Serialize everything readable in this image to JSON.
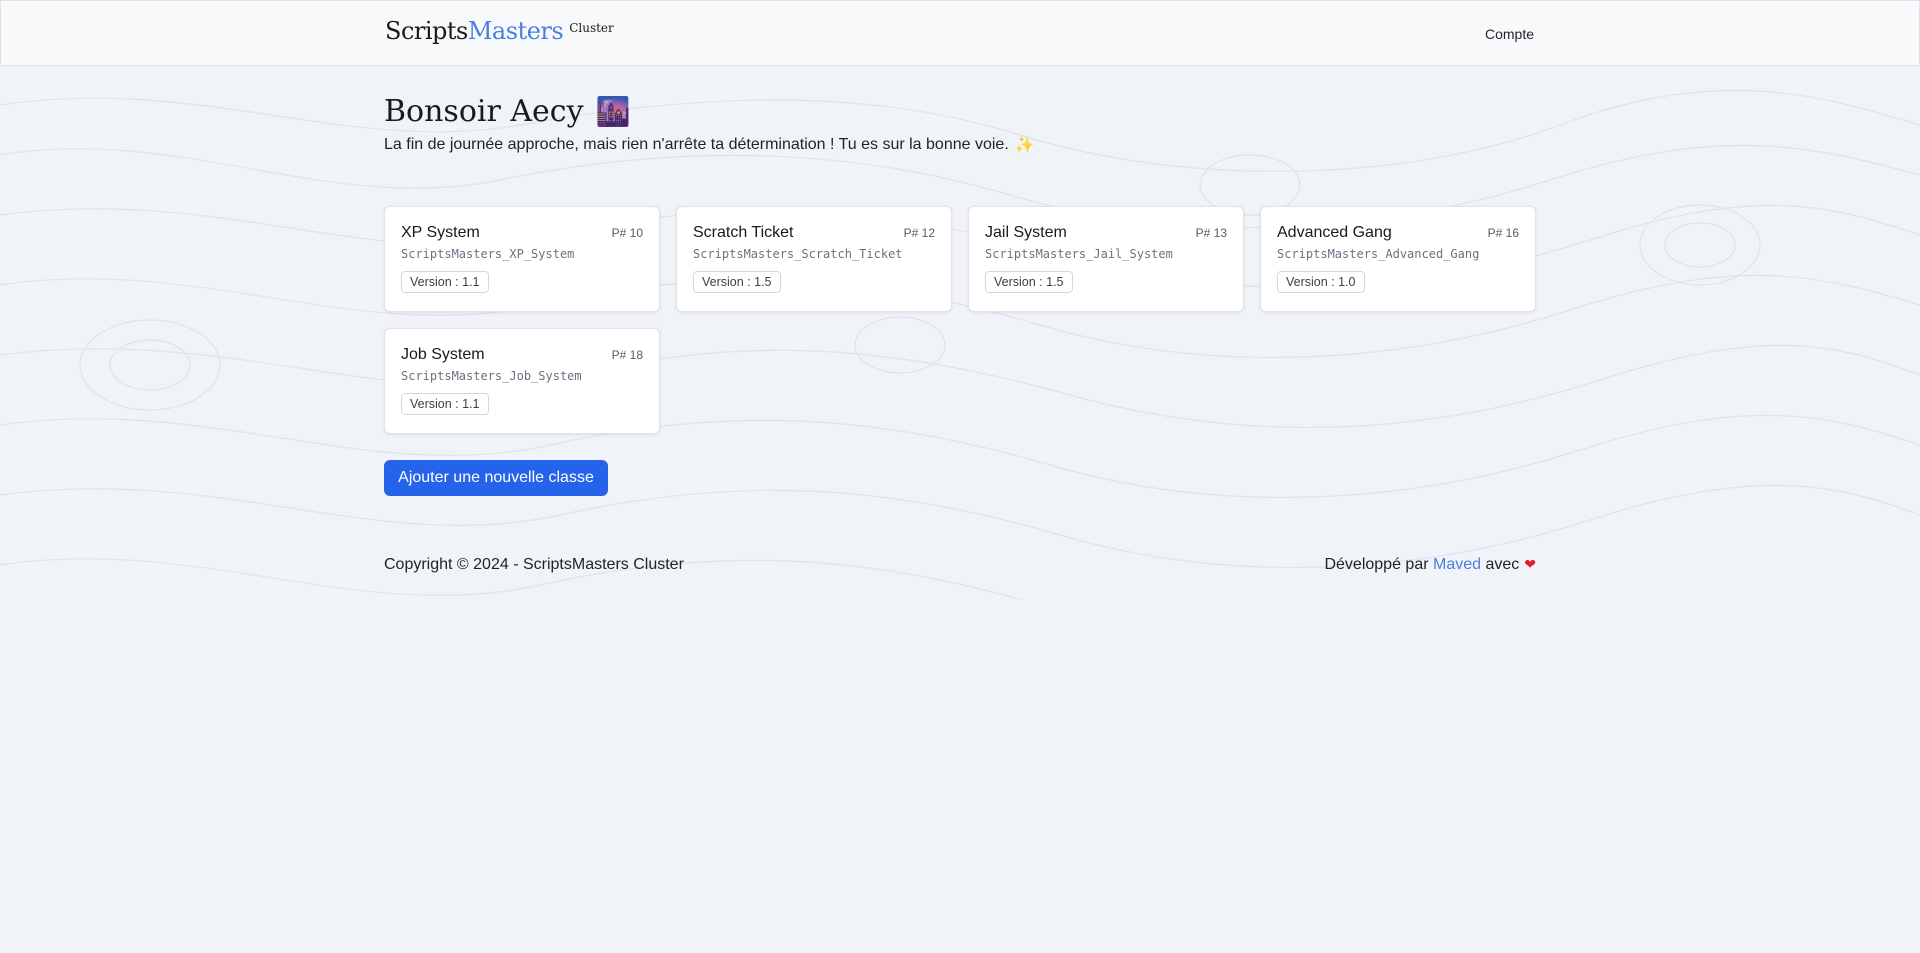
{
  "navbar": {
    "brand_part1": "Scripts",
    "brand_part2": "Masters",
    "brand_suffix": "Cluster",
    "account_label": "Compte"
  },
  "greeting": {
    "title": "Bonsoir Aecy",
    "title_emoji": "🌆",
    "subtitle": "La fin de journée approche, mais rien n'arrête ta détermination ! Tu es sur la bonne voie.",
    "subtitle_emoji": "✨"
  },
  "classes": [
    {
      "name": "XP System",
      "pid": "P# 10",
      "slug": "ScriptsMasters_XP_System",
      "version": "Version : 1.1"
    },
    {
      "name": "Scratch Ticket",
      "pid": "P# 12",
      "slug": "ScriptsMasters_Scratch_Ticket",
      "version": "Version : 1.5"
    },
    {
      "name": "Jail System",
      "pid": "P# 13",
      "slug": "ScriptsMasters_Jail_System",
      "version": "Version : 1.5"
    },
    {
      "name": "Advanced Gang",
      "pid": "P# 16",
      "slug": "ScriptsMasters_Advanced_Gang",
      "version": "Version : 1.0"
    },
    {
      "name": "Job System",
      "pid": "P# 18",
      "slug": "ScriptsMasters_Job_System",
      "version": "Version : 1.1"
    }
  ],
  "add_button_label": "Ajouter une nouvelle classe",
  "footer": {
    "copyright": "Copyright © 2024 - ScriptsMasters Cluster",
    "developed_by": "Développé par ",
    "developer_link": "Maved",
    "with": " avec",
    "heart_icon": "❤"
  },
  "colors": {
    "accent": "#2563eb",
    "brand_blue": "#4a7fe0",
    "background": "#f0f3f7"
  }
}
